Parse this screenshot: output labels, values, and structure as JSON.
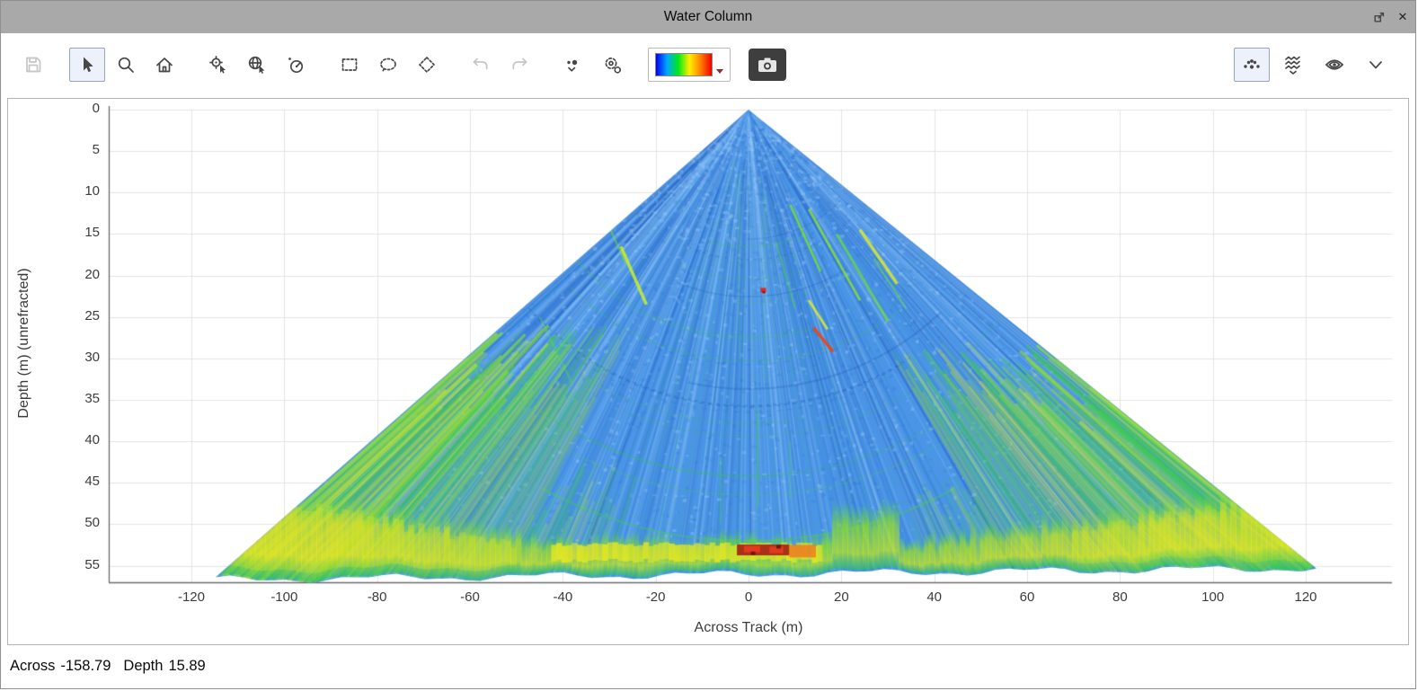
{
  "window": {
    "title": "Water Column",
    "close_glyph": "✕"
  },
  "toolbar": {
    "left_buttons": [
      {
        "name": "save",
        "icon": "floppy-disk-icon",
        "enabled": false,
        "selected": false
      },
      {
        "name": "select",
        "icon": "cursor-arrow-icon",
        "enabled": true,
        "selected": true
      },
      {
        "name": "zoom",
        "icon": "magnifier-icon",
        "enabled": true,
        "selected": false
      },
      {
        "name": "home-view",
        "icon": "home-icon",
        "enabled": true,
        "selected": false
      },
      {
        "name": "pick-point",
        "icon": "crosshair-cursor-icon",
        "enabled": true,
        "selected": false
      },
      {
        "name": "pick-geo",
        "icon": "globe-cursor-icon",
        "enabled": true,
        "selected": false
      },
      {
        "name": "beam-pick",
        "icon": "dial-icon",
        "enabled": true,
        "selected": false
      },
      {
        "name": "rectangle-select",
        "icon": "dashed-rectangle-icon",
        "enabled": true,
        "selected": false
      },
      {
        "name": "lasso-select",
        "icon": "dashed-lasso-icon",
        "enabled": true,
        "selected": false
      },
      {
        "name": "polygon-select",
        "icon": "dashed-diamond-icon",
        "enabled": true,
        "selected": false
      },
      {
        "name": "undo",
        "icon": "undo-arrow-icon",
        "enabled": false,
        "selected": false
      },
      {
        "name": "redo",
        "icon": "redo-arrow-icon",
        "enabled": false,
        "selected": false
      },
      {
        "name": "point-display-options",
        "icon": "dots-dropdown-icon",
        "enabled": true,
        "selected": false
      },
      {
        "name": "settings",
        "icon": "gears-icon",
        "enabled": true,
        "selected": false
      },
      {
        "name": "colormap-selector",
        "icon": "rainbow-colorbar",
        "enabled": true,
        "selected": false
      },
      {
        "name": "snapshot",
        "icon": "camera-icon",
        "enabled": true,
        "selected": false
      }
    ],
    "right_buttons": [
      {
        "name": "points-display",
        "icon": "scatter-dots-icon",
        "enabled": true,
        "selected": true
      },
      {
        "name": "waterfall-display",
        "icon": "wave-lines-icon",
        "enabled": true,
        "selected": false
      },
      {
        "name": "stacked-display",
        "icon": "nested-arcs-eye-icon",
        "enabled": true,
        "selected": false
      },
      {
        "name": "more-options",
        "icon": "chevron-down-icon",
        "enabled": true,
        "selected": false
      }
    ],
    "colormap_colors": [
      "#0000f0",
      "#00a8ff",
      "#00e818",
      "#fff000",
      "#ff8000",
      "#f00000"
    ]
  },
  "chart_data": {
    "type": "heatmap",
    "title": "",
    "xlabel": "Across Track (m)",
    "ylabel": "Depth (m) (unrefracted)",
    "xlim": [
      -138,
      140
    ],
    "ylim": [
      57,
      0
    ],
    "x_ticks": [
      -120,
      -100,
      -80,
      -60,
      -40,
      -20,
      0,
      20,
      40,
      60,
      80,
      100,
      120
    ],
    "y_ticks": [
      0,
      5,
      10,
      15,
      20,
      25,
      30,
      35,
      40,
      45,
      50,
      55
    ],
    "grid": true,
    "colormap": "jet (blue-cyan-green-yellow-red)",
    "description": "Multibeam echosounder water-column fan: wedge with apex at across 0 m / depth 0 m, mostly blue backscatter with green radial streaks, bright green-yellow seafloor return band near 50-56 m, red high-intensity returns at nadir seafloor and a midwater target",
    "features": {
      "apex": {
        "across": 0,
        "depth": 0
      },
      "left_edge_bottom": {
        "across": -114.8,
        "depth": 56.7
      },
      "right_edge_bottom": {
        "across": 122.3,
        "depth": 55.3
      },
      "seafloor_depth_m": 53,
      "nadir_high_intensity": {
        "across_range": [
          -2.5,
          9
        ],
        "depth_range": [
          52.4,
          53.8
        ],
        "color": "red"
      },
      "midwater_target": {
        "across": 3,
        "depth": 22,
        "color": "red"
      },
      "bright_streak_cluster": {
        "across_range": [
          8,
          34
        ],
        "depth_range": [
          11,
          29
        ],
        "color": "green-yellow with red segment"
      }
    },
    "legend": "none"
  },
  "status": {
    "across_label": "Across",
    "across_value": "-158.79",
    "depth_label": "Depth",
    "depth_value": "15.89"
  }
}
